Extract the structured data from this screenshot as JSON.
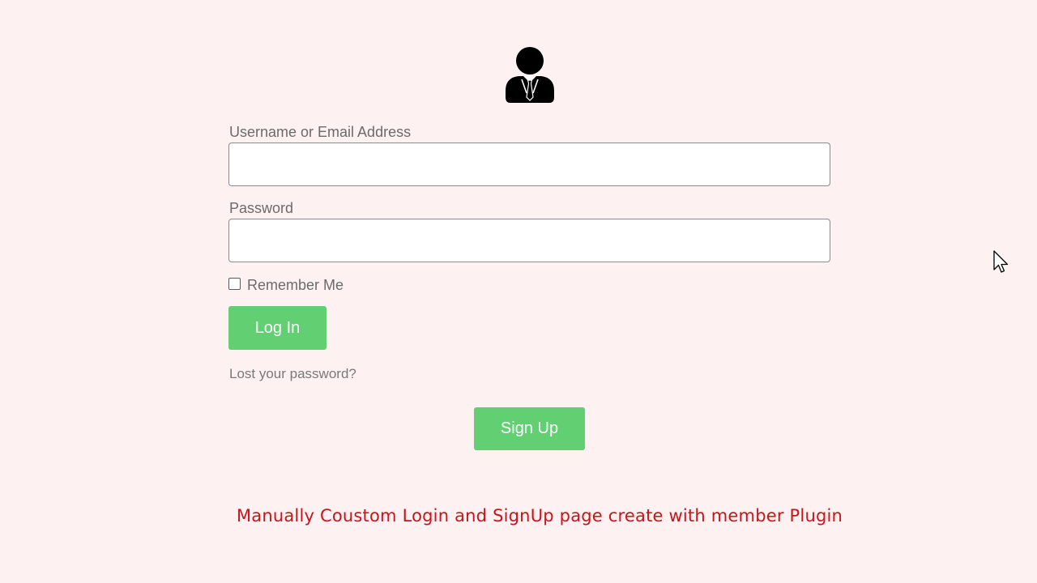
{
  "form": {
    "username_label": "Username or Email Address",
    "username_value": "",
    "password_label": "Password",
    "password_value": "",
    "remember_label": "Remember Me",
    "remember_checked": false,
    "login_button": "Log In",
    "lost_password_link": "Lost your password?",
    "signup_button": "Sign Up"
  },
  "caption": "Manually Coustom Login and SignUp page create with member Plugin",
  "icons": {
    "avatar": "user-in-suit-icon",
    "cursor": "mouse-pointer-icon"
  },
  "colors": {
    "background": "#fdf1f1",
    "button": "#63cf73",
    "caption": "#c8141a",
    "label": "#6b6b6b"
  }
}
